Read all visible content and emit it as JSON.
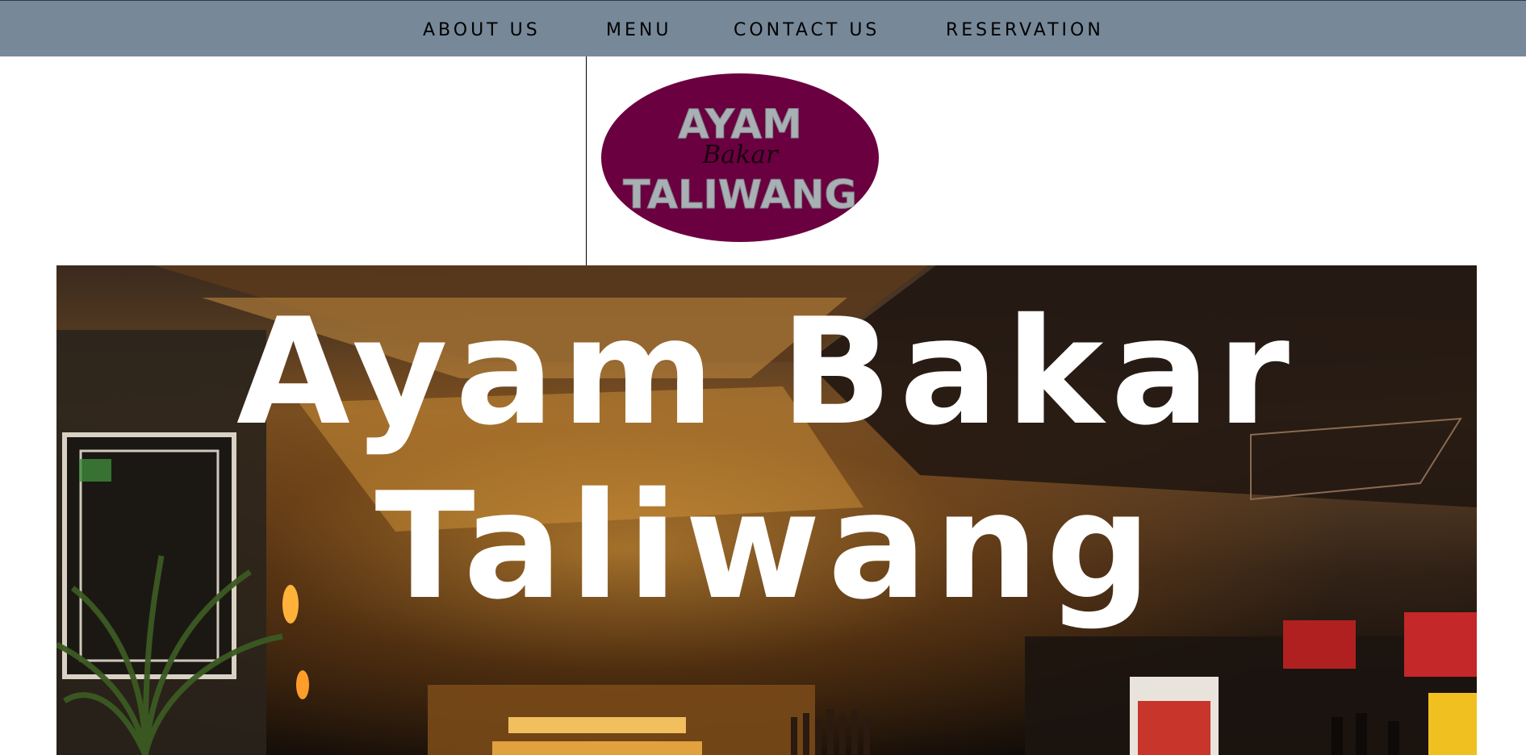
{
  "nav": {
    "items": [
      {
        "label": "ABOUT US"
      },
      {
        "label": "MENU"
      },
      {
        "label": "CONTACT US"
      },
      {
        "label": "RESERVATION"
      }
    ]
  },
  "logo": {
    "line1": "AYAM",
    "line2": "Bakar",
    "line3": "TALIWANG"
  },
  "hero": {
    "title": "Ayam Bakar Taliwang"
  },
  "colors": {
    "nav_background": "#778899",
    "logo_background": "#6b0040",
    "logo_lettering": "#a9b0b4",
    "hero_text": "#ffffff"
  }
}
